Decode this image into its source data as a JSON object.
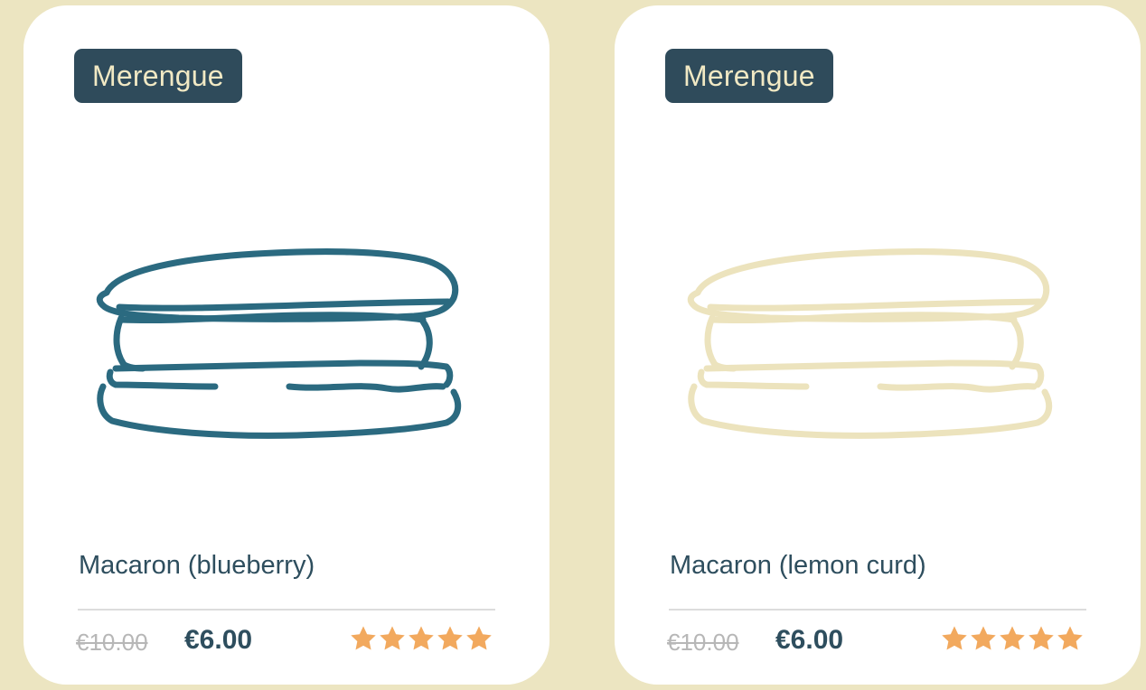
{
  "products": [
    {
      "badge": "Merengue",
      "title": "Macaron (blueberry)",
      "old_price": "€10.00",
      "new_price": "€6.00",
      "rating": 5,
      "illustration_color": "#2b6a80",
      "illustration_icon": "macaron-icon"
    },
    {
      "badge": "Merengue",
      "title": "Macaron (lemon curd)",
      "old_price": "€10.00",
      "new_price": "€6.00",
      "rating": 5,
      "illustration_color": "#ece3bd",
      "illustration_icon": "macaron-icon"
    }
  ],
  "colors": {
    "background": "#ece5c1",
    "card": "#ffffff",
    "badge_bg": "#2f4b5b",
    "badge_text": "#f1e9c4",
    "star": "#f2a95e",
    "text": "#2e4e5e"
  }
}
